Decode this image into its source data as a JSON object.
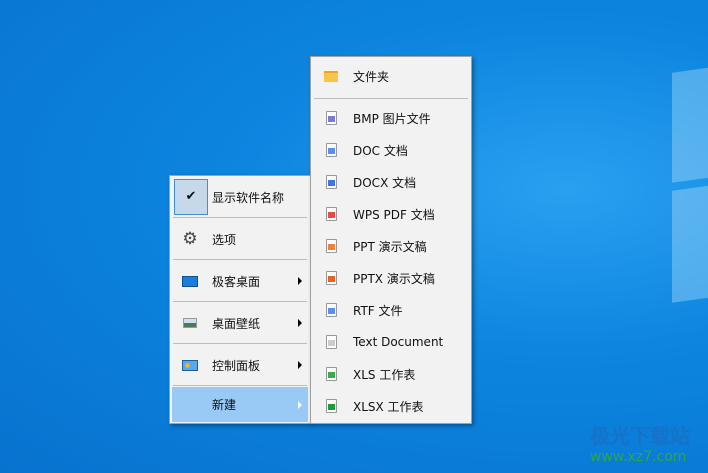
{
  "left_menu": [
    {
      "label": "显示软件名称",
      "icon": "check-icon",
      "checked": true
    },
    {
      "label": "选项",
      "icon": "gear-icon"
    },
    {
      "label": "极客桌面",
      "icon": "desktop-icon",
      "submenu": true
    },
    {
      "label": "桌面壁纸",
      "icon": "wallpaper-icon",
      "submenu": true
    },
    {
      "label": "控制面板",
      "icon": "control-panel-icon",
      "submenu": true
    },
    {
      "label": "新建",
      "icon": "",
      "submenu": true,
      "highlighted": true
    }
  ],
  "right_menu": [
    {
      "label": "文件夹",
      "icon": "folder-icon"
    },
    {
      "label": "BMP 图片文件",
      "icon": "bmp-file-icon",
      "color": "#7a7adb"
    },
    {
      "label": "DOC 文档",
      "icon": "doc-file-icon",
      "color": "#5b8ff0"
    },
    {
      "label": "DOCX 文档",
      "icon": "docx-file-icon",
      "color": "#3f73e8"
    },
    {
      "label": "WPS PDF 文档",
      "icon": "pdf-file-icon",
      "color": "#e84a4a"
    },
    {
      "label": "PPT 演示文稿",
      "icon": "ppt-file-icon",
      "color": "#f08040"
    },
    {
      "label": "PPTX 演示文稿",
      "icon": "pptx-file-icon",
      "color": "#e8602a"
    },
    {
      "label": "RTF 文件",
      "icon": "rtf-file-icon",
      "color": "#5b8ff0"
    },
    {
      "label": "Text Document",
      "icon": "text-file-icon",
      "color": "#cccccc"
    },
    {
      "label": "XLS 工作表",
      "icon": "xls-file-icon",
      "color": "#3caa4a"
    },
    {
      "label": "XLSX 工作表",
      "icon": "xlsx-file-icon",
      "color": "#229a3a"
    }
  ],
  "watermark": {
    "title": "极光下载站",
    "url": "www.xz7.com"
  }
}
